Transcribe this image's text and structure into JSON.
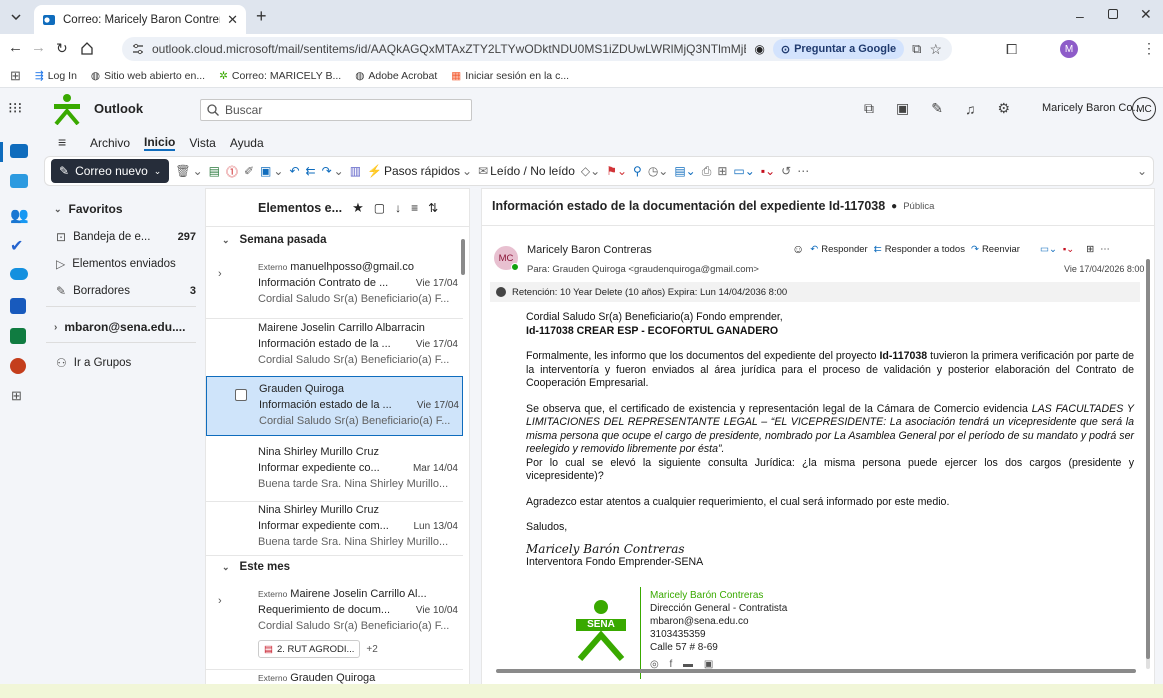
{
  "browser": {
    "tab_title": "Correo: Maricely Baron Contrer",
    "url": "outlook.cloud.microsoft/mail/sentitems/id/AAQkAGQxMTAxZTY2LTYwODktNDU0MS1iZDUwLWRlMjQ3NTlmMjE3YQAQAIJsN2Ce0PRMpCpmyc17ivA...",
    "google_button": "Preguntar a Google",
    "profile_initial": "M",
    "bookmarks": [
      "Log In",
      "Sitio web abierto en...",
      "Correo: MARICELY B...",
      "Adobe Acrobat",
      "Iniciar sesión en la c..."
    ]
  },
  "outlook": {
    "app_name": "Outlook",
    "search_placeholder": "Buscar",
    "user_name": "Maricely Baron Co...",
    "user_initials": "MC"
  },
  "ribbon": {
    "tabs": [
      "Archivo",
      "Inicio",
      "Vista",
      "Ayuda"
    ],
    "new_mail": "Correo nuevo",
    "quick_steps": "Pasos rápidos",
    "read_unread": "Leído / No leído"
  },
  "folders": {
    "favorites": "Favoritos",
    "items": [
      {
        "label": "Bandeja de e...",
        "count": "297"
      },
      {
        "label": "Elementos enviados",
        "count": ""
      },
      {
        "label": "Borradores",
        "count": "3"
      }
    ],
    "account": "mbaron@sena.edu....",
    "groups": "Ir a Grupos"
  },
  "list": {
    "title": "Elementos e...",
    "groups": [
      "Semana pasada",
      "Este mes"
    ],
    "messages": [
      {
        "tag": "Externo",
        "sender": "manuelhposso@gmail.co",
        "subject": "Información Contrato de ...",
        "date": "Vie 17/04",
        "preview": "Cordial Saludo Sr(a) Beneficiario(a) F..."
      },
      {
        "tag": "",
        "sender": "Mairene Joselin Carrillo Albarracin",
        "subject": "Información estado de la ...",
        "date": "Vie 17/04",
        "preview": "Cordial Saludo Sr(a) Beneficiario(a) F..."
      },
      {
        "tag": "",
        "sender": "Grauden Quiroga",
        "subject": "Información estado de la ...",
        "date": "Vie 17/04",
        "preview": "Cordial Saludo Sr(a) Beneficiario(a) F..."
      },
      {
        "tag": "",
        "sender": "Nina Shirley Murillo Cruz",
        "subject": "Informar expediente co...",
        "date": "Mar 14/04",
        "preview": "Buena tarde Sra. Nina Shirley Murillo..."
      },
      {
        "tag": "",
        "sender": "Nina Shirley Murillo Cruz",
        "subject": "Informar expediente com...",
        "date": "Lun 13/04",
        "preview": "Buena tarde Sra. Nina Shirley Murillo..."
      },
      {
        "tag": "Externo",
        "sender": "Mairene Joselin Carrillo Al...",
        "subject": "Requerimiento de docum...",
        "date": "Vie 10/04",
        "preview": "Cordial Saludo Sr(a) Beneficiario(a) F...",
        "attachment": "2. RUT AGRODI...",
        "more": "+2"
      },
      {
        "tag": "Externo",
        "sender": "Grauden Quiroga",
        "subject": "",
        "date": "",
        "preview": ""
      }
    ]
  },
  "email": {
    "subject": "Información estado de la documentación del expediente Id-117038",
    "visibility": "Pública",
    "sender": "Maricely Baron Contreras",
    "sender_initials": "MC",
    "to": "Para:  Grauden Quiroga <graudenquiroga@gmail.com>",
    "date": "Vie 17/04/2026 8:00",
    "reply": "Responder",
    "reply_all": "Responder a todos",
    "forward": "Reenviar",
    "retention": "Retención: 10 Year Delete (10 años) Expira: Lun 14/04/2036 8:00",
    "greeting": "Cordial Saludo Sr(a) Beneficiario(a) Fondo emprender,",
    "project_line": "Id-117038 CREAR ESP - ECOFORTUL GANADERO",
    "p1_a": "Formalmente, les informo que los documentos del expediente del proyecto ",
    "p1_b": "Id-117038",
    "p1_c": " tuvieron la primera verificación por parte de la interventoría y fueron enviados al área jurídica para el proceso de validación y posterior elaboración del Contrato de Cooperación Empresarial.",
    "p2_a": "Se observa que, el certificado de existencia y representación legal de la Cámara de Comercio evidencia ",
    "p2_b": "LAS FACULTADES Y LIMITACIONES DEL REPRESENTANTE LEGAL – “EL VICEPRESIDENTE: La asociación tendrá un vicepresidente que será la misma persona que ocupe el cargo de presidente, nombrado por La Asamblea General por el período de su mandato y podrá ser reelegido y removido libremente por ésta”.",
    "p2_c": "Por lo cual se elevó la siguiente consulta Jurídica: ¿la misma persona puede ejercer los dos cargos (presidente y vicepresidente)?",
    "p3": "Agradezco estar atentos a cualquier requerimiento, el cual será informado por este medio.",
    "closing": "Saludos,",
    "signature": "Maricely Barón Contreras",
    "role": "Interventora Fondo Emprender-SENA",
    "sig_name": "Maricely Barón Contreras",
    "sig_dept": "Dirección General - Contratista",
    "sig_email": "mbaron@sena.edu.co",
    "sig_phone": "3103435359",
    "sig_addr": "Calle 57 # 8-69",
    "logo_text": "SENA"
  },
  "colors": {
    "accent": "#0f6cbd",
    "sena_green": "#39a900",
    "selected": "#cfe4fa"
  }
}
